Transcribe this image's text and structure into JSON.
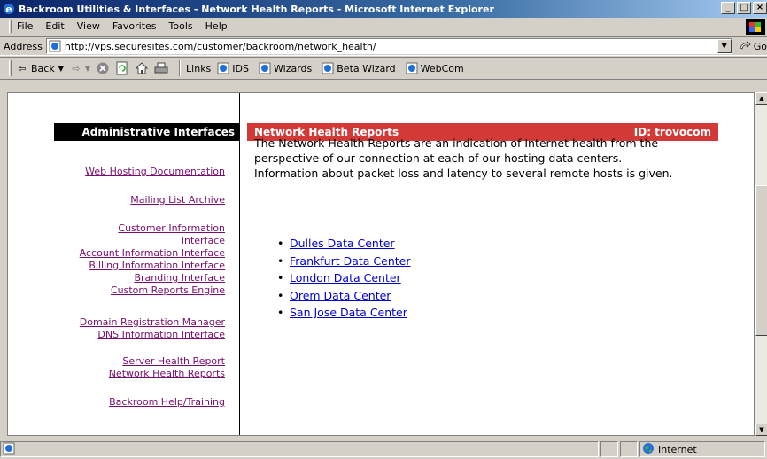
{
  "window": {
    "title": "Backroom Utilities & Interfaces - Network Health Reports - Microsoft Internet Explorer",
    "controls": [
      "_",
      "□",
      "×"
    ]
  },
  "menu": [
    "File",
    "Edit",
    "View",
    "Favorites",
    "Tools",
    "Help"
  ],
  "address": {
    "label": "Address",
    "url": "http://vps.securesites.com/customer/backroom/network_health/",
    "go_label": "Go"
  },
  "toolbar": {
    "back_label": "Back",
    "links_label": "Links",
    "links": [
      "IDS",
      "Wizards",
      "Beta Wizard",
      "WebCom"
    ]
  },
  "sidebar": {
    "header": "Administrative Interfaces",
    "items": [
      "Web Hosting Documentation",
      "Mailing List Archive",
      "Customer Information",
      "Interface",
      "Account Information Interface",
      "Billing Information Interface",
      "Branding Interface",
      "Custom Reports Engine",
      "Domain Registration Manager",
      "DNS Information Interface",
      "Server Health Report",
      "Network Health Reports",
      "Backroom Help/Training"
    ]
  },
  "main": {
    "title": "Network Health Reports",
    "id_text": "ID: trovocom",
    "intro_lines": [
      "The Network Health Reports are an indication of Internet health from the",
      "perspective of our connection at each of our hosting data centers.",
      "Information about packet loss and latency to several remote hosts is given."
    ],
    "data_centers": [
      "Dulles Data Center",
      "Frankfurt Data Center",
      "London Data Center",
      "Orem Data Center",
      "San Jose Data Center"
    ]
  },
  "status": {
    "zone": "Internet"
  },
  "colors": {
    "header_red": "#d33936",
    "visited_link": "#7a0e6e",
    "link": "#0000cc"
  }
}
